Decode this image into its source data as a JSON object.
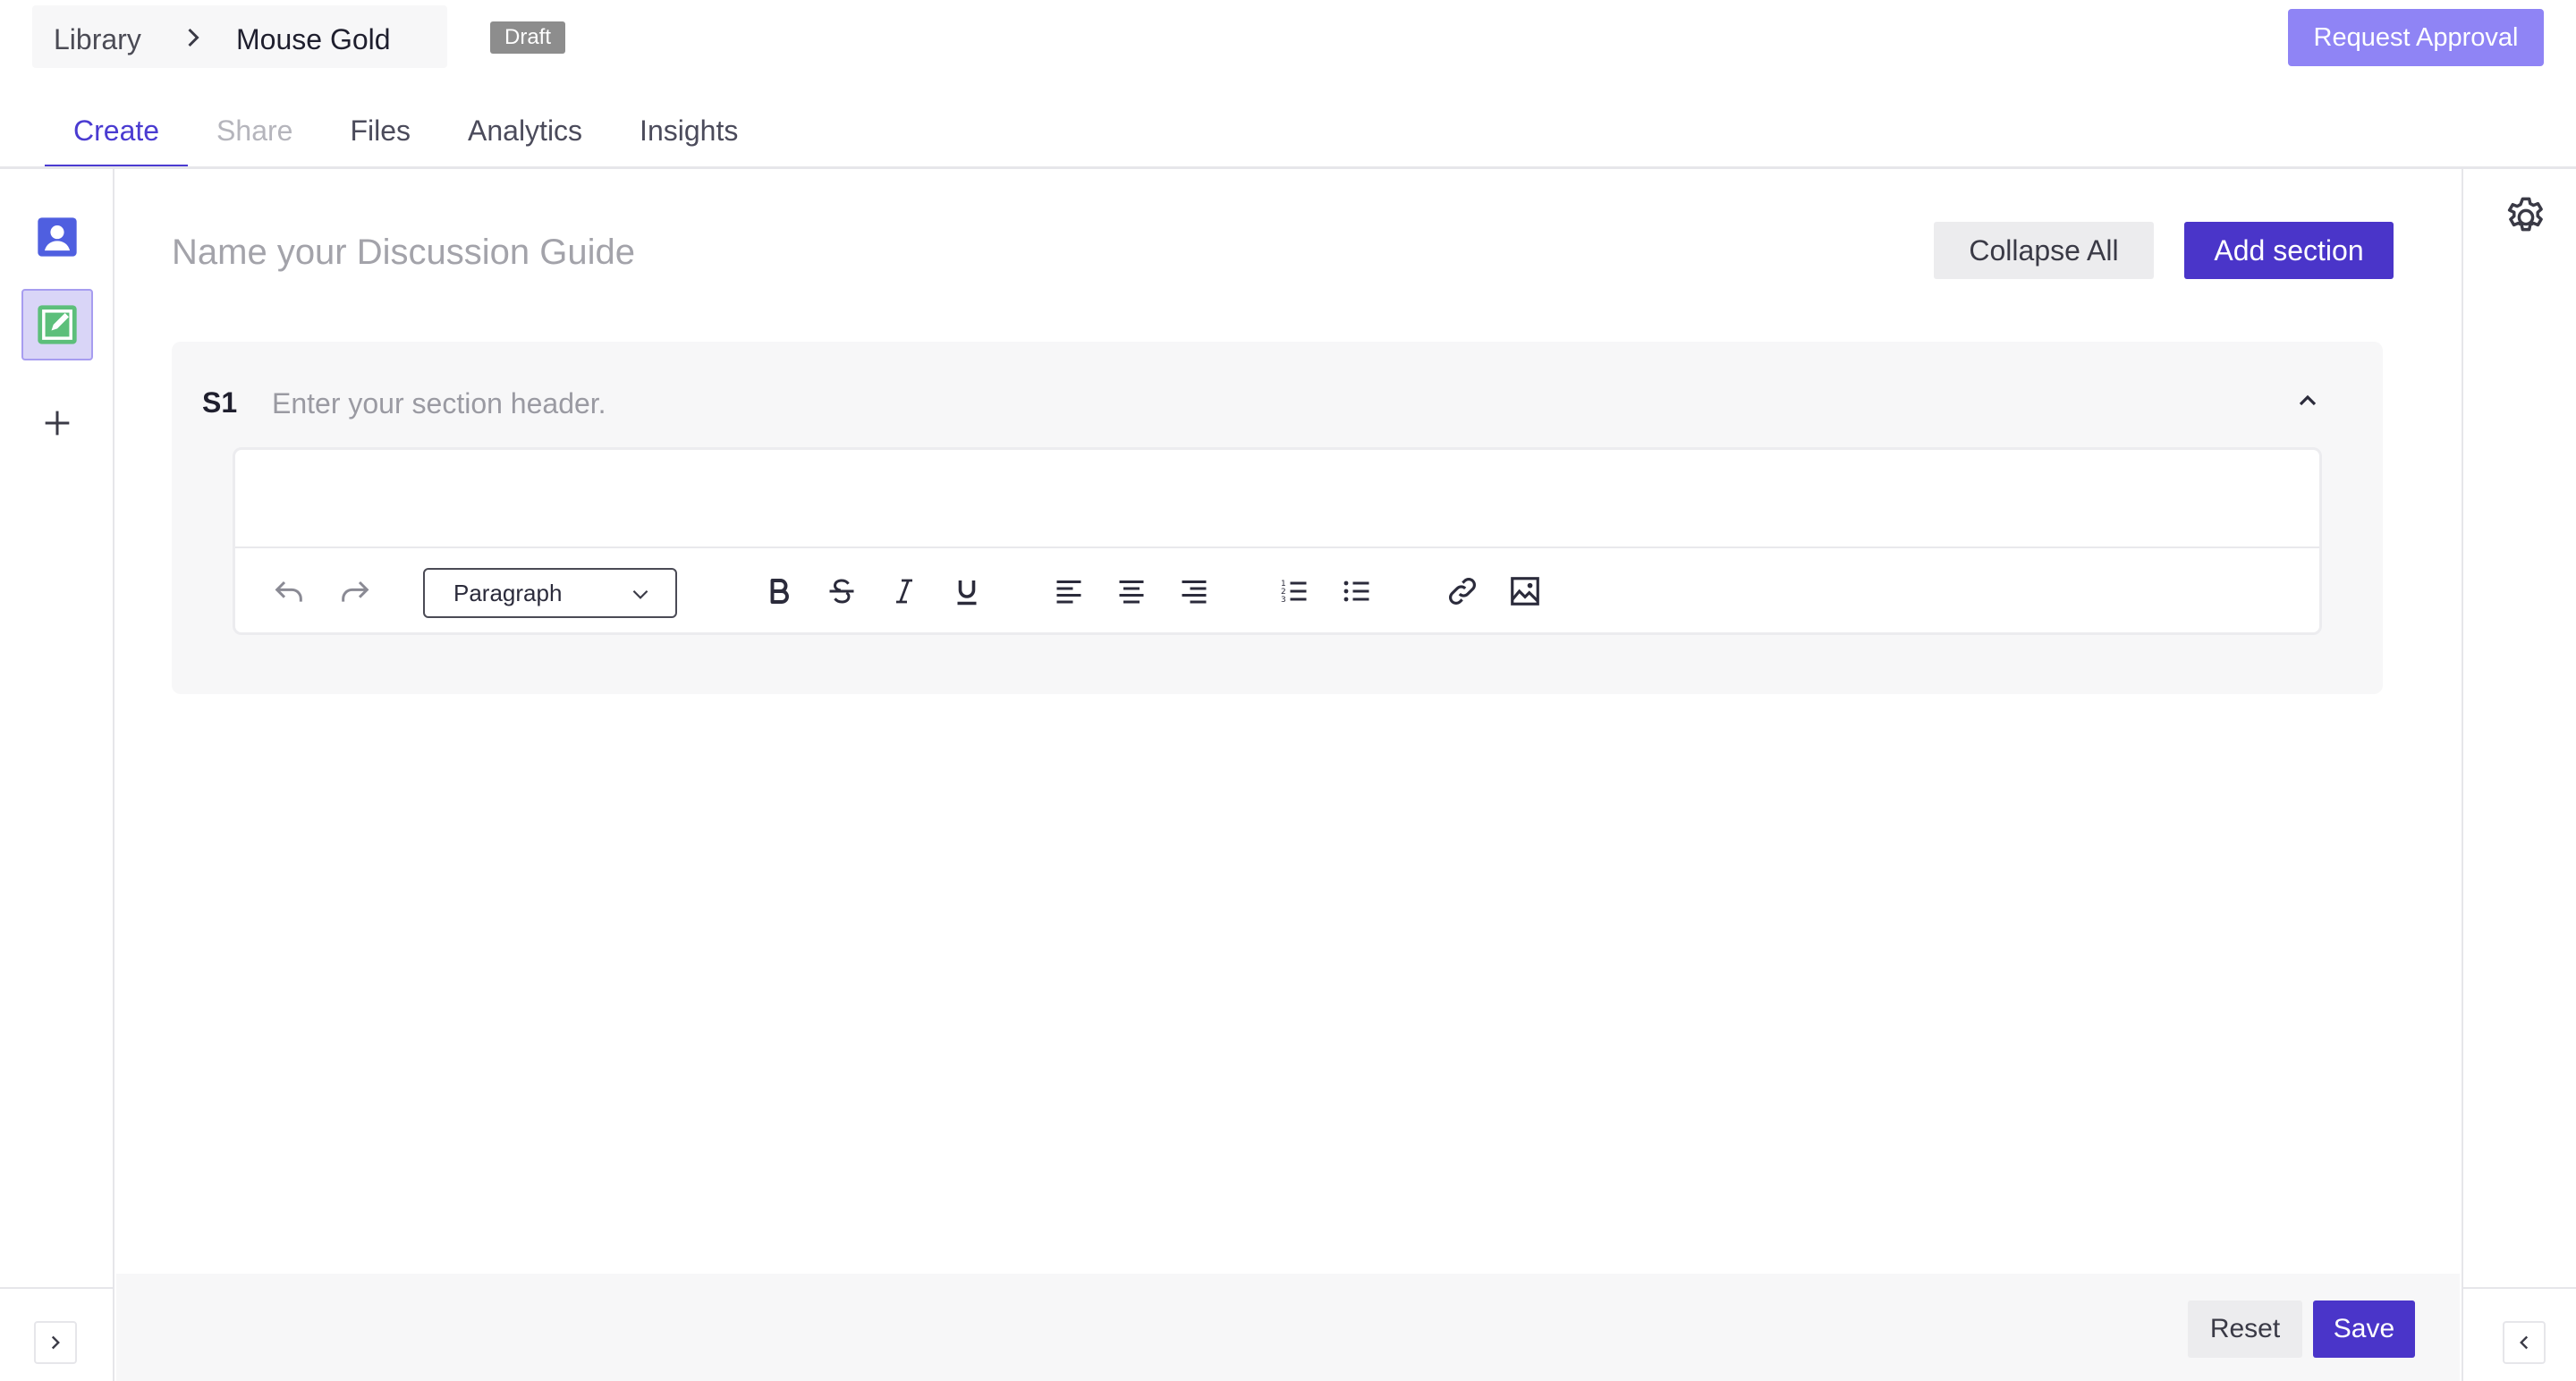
{
  "header": {
    "breadcrumb": {
      "root": "Library",
      "current": "Mouse Gold"
    },
    "status_badge": "Draft",
    "request_approval_label": "Request Approval"
  },
  "tabs": [
    {
      "label": "Create",
      "state": "active"
    },
    {
      "label": "Share",
      "state": "disabled"
    },
    {
      "label": "Files",
      "state": "normal"
    },
    {
      "label": "Analytics",
      "state": "normal"
    },
    {
      "label": "Insights",
      "state": "normal"
    }
  ],
  "left_rail": {
    "items": [
      {
        "icon": "contact-card-icon",
        "color": "#4f5fe0"
      },
      {
        "icon": "edit-note-icon",
        "color": "#5cbf7a",
        "selected": true
      },
      {
        "icon": "plus-icon"
      }
    ],
    "expand_icon": "chevron-right-icon"
  },
  "right_rail": {
    "settings_icon": "gear-icon",
    "collapse_icon": "chevron-left-icon"
  },
  "main": {
    "guide_name_placeholder": "Name your Discussion Guide",
    "guide_name_value": "",
    "collapse_all_label": "Collapse All",
    "add_section_label": "Add section",
    "sections": [
      {
        "code": "S1",
        "header_placeholder": "Enter your section header.",
        "header_value": "",
        "body": ""
      }
    ],
    "toolbar": {
      "paragraph_style": "Paragraph",
      "tools": [
        "undo-icon",
        "redo-icon",
        "bold-icon",
        "strikethrough-icon",
        "italic-icon",
        "underline-icon",
        "align-left-icon",
        "align-center-icon",
        "align-right-icon",
        "ordered-list-icon",
        "bullet-list-icon",
        "link-icon",
        "image-icon"
      ]
    }
  },
  "footer": {
    "reset_label": "Reset",
    "save_label": "Save"
  },
  "colors": {
    "accent": "#4a35c9",
    "accent_light": "#8f84f5",
    "badge": "#8d8d8d"
  }
}
